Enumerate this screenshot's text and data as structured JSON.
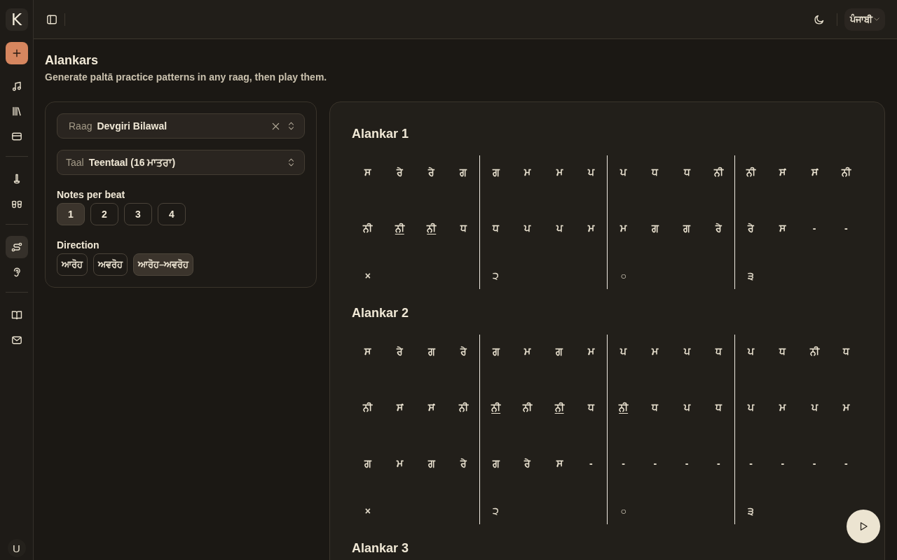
{
  "app": {
    "logo": "K"
  },
  "nav_groups": [
    {
      "items": [
        {
          "selected": false
        },
        {
          "selected": false
        },
        {
          "selected": false
        }
      ]
    },
    {
      "items": [
        {
          "selected": false
        },
        {
          "selected": false
        }
      ]
    },
    {
      "items": [
        {
          "selected": true
        },
        {
          "selected": false
        }
      ]
    },
    {
      "items": [
        {
          "selected": false
        },
        {
          "selected": false
        }
      ]
    }
  ],
  "user": {
    "initial": "U"
  },
  "top_bar": {
    "language": "ਪੰਜਾਬੀ"
  },
  "page": {
    "title": "Alankars",
    "subtitle": "Generate paltā practice patterns in any raag, then play them."
  },
  "settings": {
    "raag": {
      "label": "Raag",
      "value": "Devgiri Bilawal"
    },
    "taal": {
      "label": "Taal",
      "value": "Teentaal (16 ਮਾਤਰਾ)"
    },
    "notes_per_beat": {
      "label": "Notes per beat",
      "options": [
        {
          "label": "1",
          "selected": true
        },
        {
          "label": "2",
          "selected": false
        },
        {
          "label": "3",
          "selected": false
        },
        {
          "label": "4",
          "selected": false
        }
      ]
    },
    "direction": {
      "label": "Direction",
      "options": [
        {
          "label": "ਆਰੋਹ",
          "selected": false
        },
        {
          "label": "ਅਵਰੋਹ",
          "selected": false
        },
        {
          "label": "ਆਰੋਹ–ਅਵਰੋਹ",
          "selected": true
        }
      ]
    }
  },
  "alankars": [
    {
      "title": "Alankar 1",
      "rows": [
        [
          {
            "note": "ਸ",
            "komal": false
          },
          {
            "note": "ਰੇ",
            "komal": false
          },
          {
            "note": "ਰੇ",
            "komal": false
          },
          {
            "note": "ਗ",
            "komal": false
          },
          {
            "note": "ਗ",
            "komal": false
          },
          {
            "note": "ਮ",
            "komal": false
          },
          {
            "note": "ਮ",
            "komal": false
          },
          {
            "note": "ਪ",
            "komal": false
          },
          {
            "note": "ਪ",
            "komal": false
          },
          {
            "note": "ਧ",
            "komal": false
          },
          {
            "note": "ਧ",
            "komal": false
          },
          {
            "note": "ਨੀ",
            "komal": false
          },
          {
            "note": "ਨੀ",
            "komal": false
          },
          {
            "note": "ਸਂ",
            "komal": false
          },
          {
            "note": "ਸਂ",
            "komal": false
          },
          {
            "note": "ਨੀ",
            "komal": false
          }
        ],
        [
          {
            "note": "ਨੀ",
            "komal": false
          },
          {
            "note": "ਨੀ",
            "komal": true
          },
          {
            "note": "ਨੀ",
            "komal": true
          },
          {
            "note": "ਧ",
            "komal": false
          },
          {
            "note": "ਧ",
            "komal": false
          },
          {
            "note": "ਪ",
            "komal": false
          },
          {
            "note": "ਪ",
            "komal": false
          },
          {
            "note": "ਮ",
            "komal": false
          },
          {
            "note": "ਮ",
            "komal": false
          },
          {
            "note": "ਗ",
            "komal": false
          },
          {
            "note": "ਗ",
            "komal": false
          },
          {
            "note": "ਰੇ",
            "komal": false
          },
          {
            "note": "ਰੇ",
            "komal": false
          },
          {
            "note": "ਸ",
            "komal": false
          },
          {
            "note": "-",
            "komal": false
          },
          {
            "note": "-",
            "komal": false
          }
        ]
      ],
      "taal_marks": [
        "×",
        "੨",
        "○",
        "੩"
      ]
    },
    {
      "title": "Alankar 2",
      "rows": [
        [
          {
            "note": "ਸ",
            "komal": false
          },
          {
            "note": "ਰੇ",
            "komal": false
          },
          {
            "note": "ਗ",
            "komal": false
          },
          {
            "note": "ਰੇ",
            "komal": false
          },
          {
            "note": "ਗ",
            "komal": false
          },
          {
            "note": "ਮ",
            "komal": false
          },
          {
            "note": "ਗ",
            "komal": false
          },
          {
            "note": "ਮ",
            "komal": false
          },
          {
            "note": "ਪ",
            "komal": false
          },
          {
            "note": "ਮ",
            "komal": false
          },
          {
            "note": "ਪ",
            "komal": false
          },
          {
            "note": "ਧ",
            "komal": false
          },
          {
            "note": "ਪ",
            "komal": false
          },
          {
            "note": "ਧ",
            "komal": false
          },
          {
            "note": "ਨੀ",
            "komal": false
          },
          {
            "note": "ਧ",
            "komal": false
          }
        ],
        [
          {
            "note": "ਨੀ",
            "komal": false
          },
          {
            "note": "ਸਂ",
            "komal": false
          },
          {
            "note": "ਸਂ",
            "komal": false
          },
          {
            "note": "ਨੀ",
            "komal": false
          },
          {
            "note": "ਨੀ",
            "komal": true
          },
          {
            "note": "ਨੀ",
            "komal": false
          },
          {
            "note": "ਨੀ",
            "komal": true
          },
          {
            "note": "ਧ",
            "komal": false
          },
          {
            "note": "ਨੀ",
            "komal": true
          },
          {
            "note": "ਧ",
            "komal": false
          },
          {
            "note": "ਪ",
            "komal": false
          },
          {
            "note": "ਧ",
            "komal": false
          },
          {
            "note": "ਪ",
            "komal": false
          },
          {
            "note": "ਮ",
            "komal": false
          },
          {
            "note": "ਪ",
            "komal": false
          },
          {
            "note": "ਮ",
            "komal": false
          }
        ],
        [
          {
            "note": "ਗ",
            "komal": false
          },
          {
            "note": "ਮ",
            "komal": false
          },
          {
            "note": "ਗ",
            "komal": false
          },
          {
            "note": "ਰੇ",
            "komal": false
          },
          {
            "note": "ਗ",
            "komal": false
          },
          {
            "note": "ਰੇ",
            "komal": false
          },
          {
            "note": "ਸ",
            "komal": false
          },
          {
            "note": "-",
            "komal": false
          },
          {
            "note": "-",
            "komal": false
          },
          {
            "note": "-",
            "komal": false
          },
          {
            "note": "-",
            "komal": false
          },
          {
            "note": "-",
            "komal": false
          },
          {
            "note": "-",
            "komal": false
          },
          {
            "note": "-",
            "komal": false
          },
          {
            "note": "-",
            "komal": false
          },
          {
            "note": "-",
            "komal": false
          }
        ]
      ],
      "taal_marks": [
        "×",
        "੨",
        "○",
        "੩"
      ]
    },
    {
      "title": "Alankar 3"
    }
  ]
}
